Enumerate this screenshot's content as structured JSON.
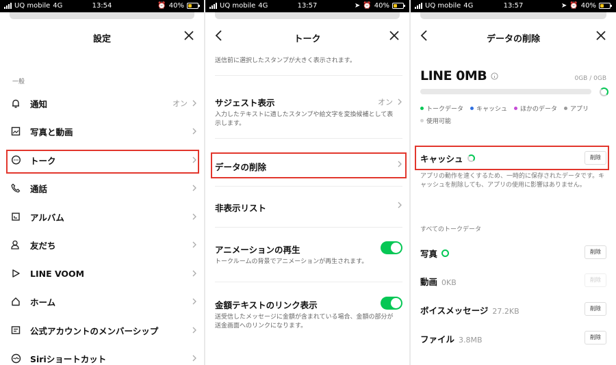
{
  "status_bars": [
    {
      "carrier": "UQ mobile",
      "network": "4G",
      "time": "13:54",
      "battery": "40%"
    },
    {
      "carrier": "UQ mobile",
      "network": "4G",
      "time": "13:57",
      "battery": "40%"
    },
    {
      "carrier": "UQ mobile",
      "network": "4G",
      "time": "13:57",
      "battery": "40%"
    }
  ],
  "settings": {
    "title": "設定",
    "section": "一般",
    "items": [
      {
        "label": "通知",
        "value": "オン",
        "icon": "bell-icon"
      },
      {
        "label": "写真と動画",
        "value": "",
        "icon": "photo-icon"
      },
      {
        "label": "トーク",
        "value": "",
        "icon": "chat-bubble-icon"
      },
      {
        "label": "通話",
        "value": "",
        "icon": "phone-icon"
      },
      {
        "label": "アルバム",
        "value": "",
        "icon": "album-icon"
      },
      {
        "label": "友だち",
        "value": "",
        "icon": "friends-icon"
      },
      {
        "label": "LINE VOOM",
        "value": "",
        "icon": "voom-icon"
      },
      {
        "label": "ホーム",
        "value": "",
        "icon": "home-icon"
      },
      {
        "label": "公式アカウントのメンバーシップ",
        "value": "",
        "icon": "membership-icon"
      },
      {
        "label": "Siriショートカット",
        "value": "",
        "icon": "siri-icon"
      }
    ]
  },
  "talk": {
    "title": "トーク",
    "top_desc": "送信前に選択したスタンプが大きく表示されます。",
    "suggest": {
      "title": "サジェスト表示",
      "value": "オン",
      "desc": "入力したテキストに適したスタンプや絵文字を変換候補として表示します。"
    },
    "delete_data": {
      "title": "データの削除"
    },
    "hidden_list": {
      "title": "非表示リスト"
    },
    "animation": {
      "title": "アニメーションの再生",
      "desc": "トークルームの背景でアニメーションが再生されます。"
    },
    "amount_link": {
      "title": "金額テキストのリンク表示",
      "desc": "送受信したメッセージに金額が含まれている場合、金額の部分が送金画面へのリンクになります。"
    }
  },
  "data_delete": {
    "title": "データの削除",
    "storage_title": "LINE 0MB",
    "storage_total": "0GB / 0GB",
    "legend": [
      {
        "label": "トークデータ",
        "color": "#06c755"
      },
      {
        "label": "キャッシュ",
        "color": "#2f6fe0"
      },
      {
        "label": "ほかのデータ",
        "color": "#c54bd6"
      },
      {
        "label": "アプリ",
        "color": "#9a9a9a"
      },
      {
        "label": "使用可能",
        "color": "#d4d4d4"
      }
    ],
    "cache": {
      "title": "キャッシュ",
      "button": "削除",
      "desc": "アプリの動作を速くするため、一時的に保存されたデータです。キャッシュを削除しても、アプリの使用に影響はありません。"
    },
    "section_label": "すべてのトークデータ",
    "rows": [
      {
        "name": "写真",
        "size": "",
        "button": "削除"
      },
      {
        "name": "動画",
        "size": "0KB",
        "button": "削除"
      },
      {
        "name": "ボイスメッセージ",
        "size": "27.2KB",
        "button": "削除"
      },
      {
        "name": "ファイル",
        "size": "3.8MB",
        "button": "削除"
      }
    ]
  }
}
